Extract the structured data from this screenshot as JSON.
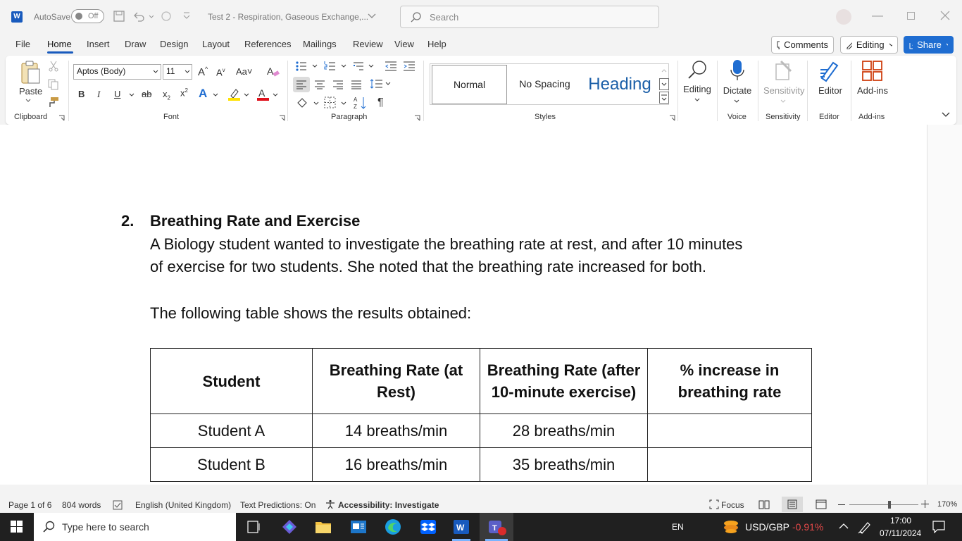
{
  "titlebar": {
    "app_letter": "W",
    "autosave_label": "AutoSave",
    "autosave_state": "Off",
    "doc_title": "Test 2 - Respiration, Gaseous Exchange,...",
    "search_placeholder": "Search"
  },
  "menu": {
    "items": [
      "File",
      "Home",
      "Insert",
      "Draw",
      "Design",
      "Layout",
      "References",
      "Mailings",
      "Review",
      "View",
      "Help"
    ],
    "active": "Home",
    "comments": "Comments",
    "editing": "Editing",
    "share": "Share"
  },
  "ribbon": {
    "clipboard": {
      "paste": "Paste",
      "label": "Clipboard"
    },
    "font": {
      "name": "Aptos (Body)",
      "size": "11",
      "label": "Font"
    },
    "paragraph": {
      "label": "Paragraph"
    },
    "styles": {
      "items": [
        "Normal",
        "No Spacing",
        "Heading"
      ],
      "label": "Styles"
    },
    "editing": {
      "label": "Editing"
    },
    "voice": {
      "button": "Dictate",
      "label": "Voice"
    },
    "sensitivity": {
      "button": "Sensitivity",
      "label": "Sensitivity"
    },
    "editor": {
      "button": "Editor",
      "label": "Editor"
    },
    "addins": {
      "button": "Add-ins",
      "label": "Add-ins"
    }
  },
  "document": {
    "question_number": "2.",
    "heading": "Breathing Rate and Exercise",
    "para1_line1": "A Biology student wanted to investigate the breathing rate at rest, and after 10 minutes",
    "para1_line2": "of exercise for two students. She noted that the breathing rate increased for both.",
    "para2": "The following table shows the results obtained:",
    "table": {
      "headers": [
        "Student",
        "Breathing Rate (at Rest)",
        "Breathing Rate (after 10-minute exercise)",
        "% increase in breathing rate"
      ],
      "rows": [
        [
          "Student A",
          "14 breaths/min",
          "28 breaths/min",
          ""
        ],
        [
          "Student B",
          "16 breaths/min",
          "35 breaths/min",
          ""
        ]
      ]
    }
  },
  "status": {
    "page": "Page 1 of 6",
    "words": "804 words",
    "language": "English (United Kingdom)",
    "predictions": "Text Predictions: On",
    "accessibility": "Accessibility: Investigate",
    "focus": "Focus",
    "zoom": "170%"
  },
  "taskbar": {
    "search_placeholder": "Type here to search",
    "lang": "EN",
    "ticker": "USD/GBP",
    "ticker_change": "-0.91%",
    "ticker_color": "#e84a4a",
    "time": "17:00",
    "date": "07/11/2024"
  }
}
